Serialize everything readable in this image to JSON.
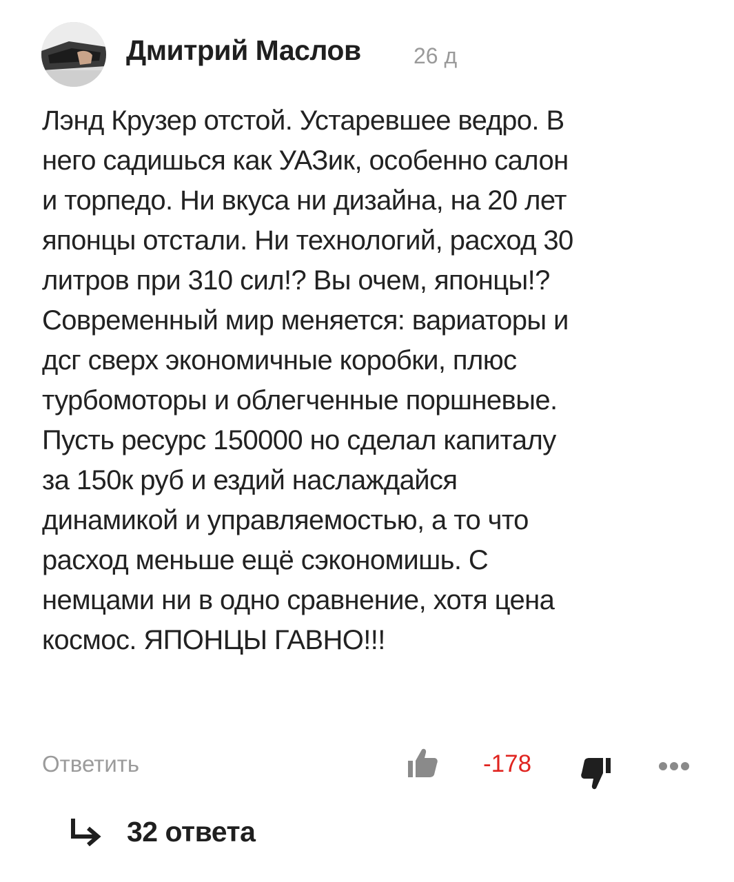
{
  "comment": {
    "author": "Дмитрий Маслов",
    "age": "26 д",
    "avatar_icon": "user-avatar-photo",
    "body_lines": [
      "Лэнд Крузер отстой. Устаревшее ведро. В",
      "него садишься как УАЗик, особенно салон",
      "и торпедо. Ни вкуса ни дизайна, на 20 лет",
      "японцы отстали. Ни технологий, расход 30",
      "литров при 310 сил!? Вы очем, японцы!?",
      "Современный мир меняется: вариаторы и",
      "дсг сверх экономичные коробки, плюс",
      "турбомоторы и облегченные поршневые.",
      "Пусть ресурс 150000 но сделал капиталу",
      "за 150к руб и ездий наслаждайся",
      "динамикой и управляемостью, а то что",
      "расход меньше ещё сэкономишь. С",
      "немцами ни в одно сравнение, хотя цена",
      "космос. ЯПОНЦЫ ГАВНО!!!"
    ]
  },
  "actions": {
    "reply_label": "Ответить",
    "score": "-178",
    "score_color": "#e0241f",
    "like_icon": "thumbs-up-icon",
    "dislike_icon": "thumbs-down-icon",
    "more_icon": "more-dots-icon"
  },
  "replies": {
    "label": "32 ответа",
    "icon": "reply-arrow-icon"
  }
}
